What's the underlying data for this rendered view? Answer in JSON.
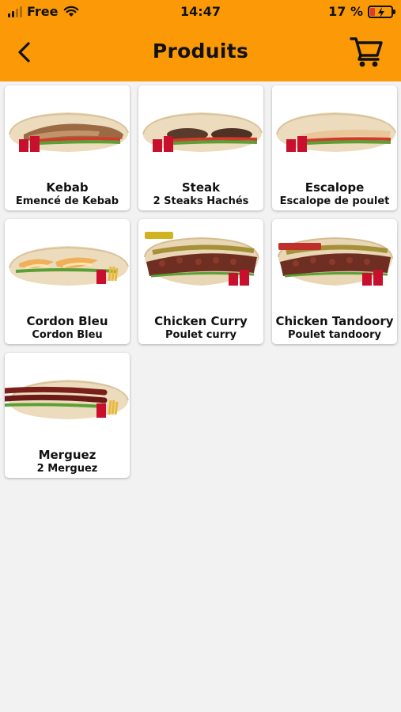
{
  "status": {
    "carrier": "Free",
    "time": "14:47",
    "battery": "17 %"
  },
  "header": {
    "title": "Produits"
  },
  "products": [
    {
      "name": "Kebab",
      "description": "Emencé de Kebab",
      "filling": "kebab"
    },
    {
      "name": "Steak",
      "description": "2 Steaks Hachés",
      "filling": "steak"
    },
    {
      "name": "Escalope",
      "description": "Escalope de poulet",
      "filling": "chicken"
    },
    {
      "name": "Cordon Bleu",
      "description": "Cordon Bleu",
      "filling": "cordon-bleu"
    },
    {
      "name": "Chicken Curry",
      "description": "Poulet curry",
      "filling": "curry",
      "tag": "CURRY"
    },
    {
      "name": "Chicken Tandoory",
      "description": "Poulet tandoory",
      "filling": "tandoori",
      "tag": "TANDOORY"
    },
    {
      "name": "Merguez",
      "description": "2 Merguez",
      "filling": "merguez"
    }
  ],
  "colors": {
    "header": "#fb9a06",
    "background": "#f2f2f2",
    "card": "#ffffff",
    "text": "#111111"
  }
}
